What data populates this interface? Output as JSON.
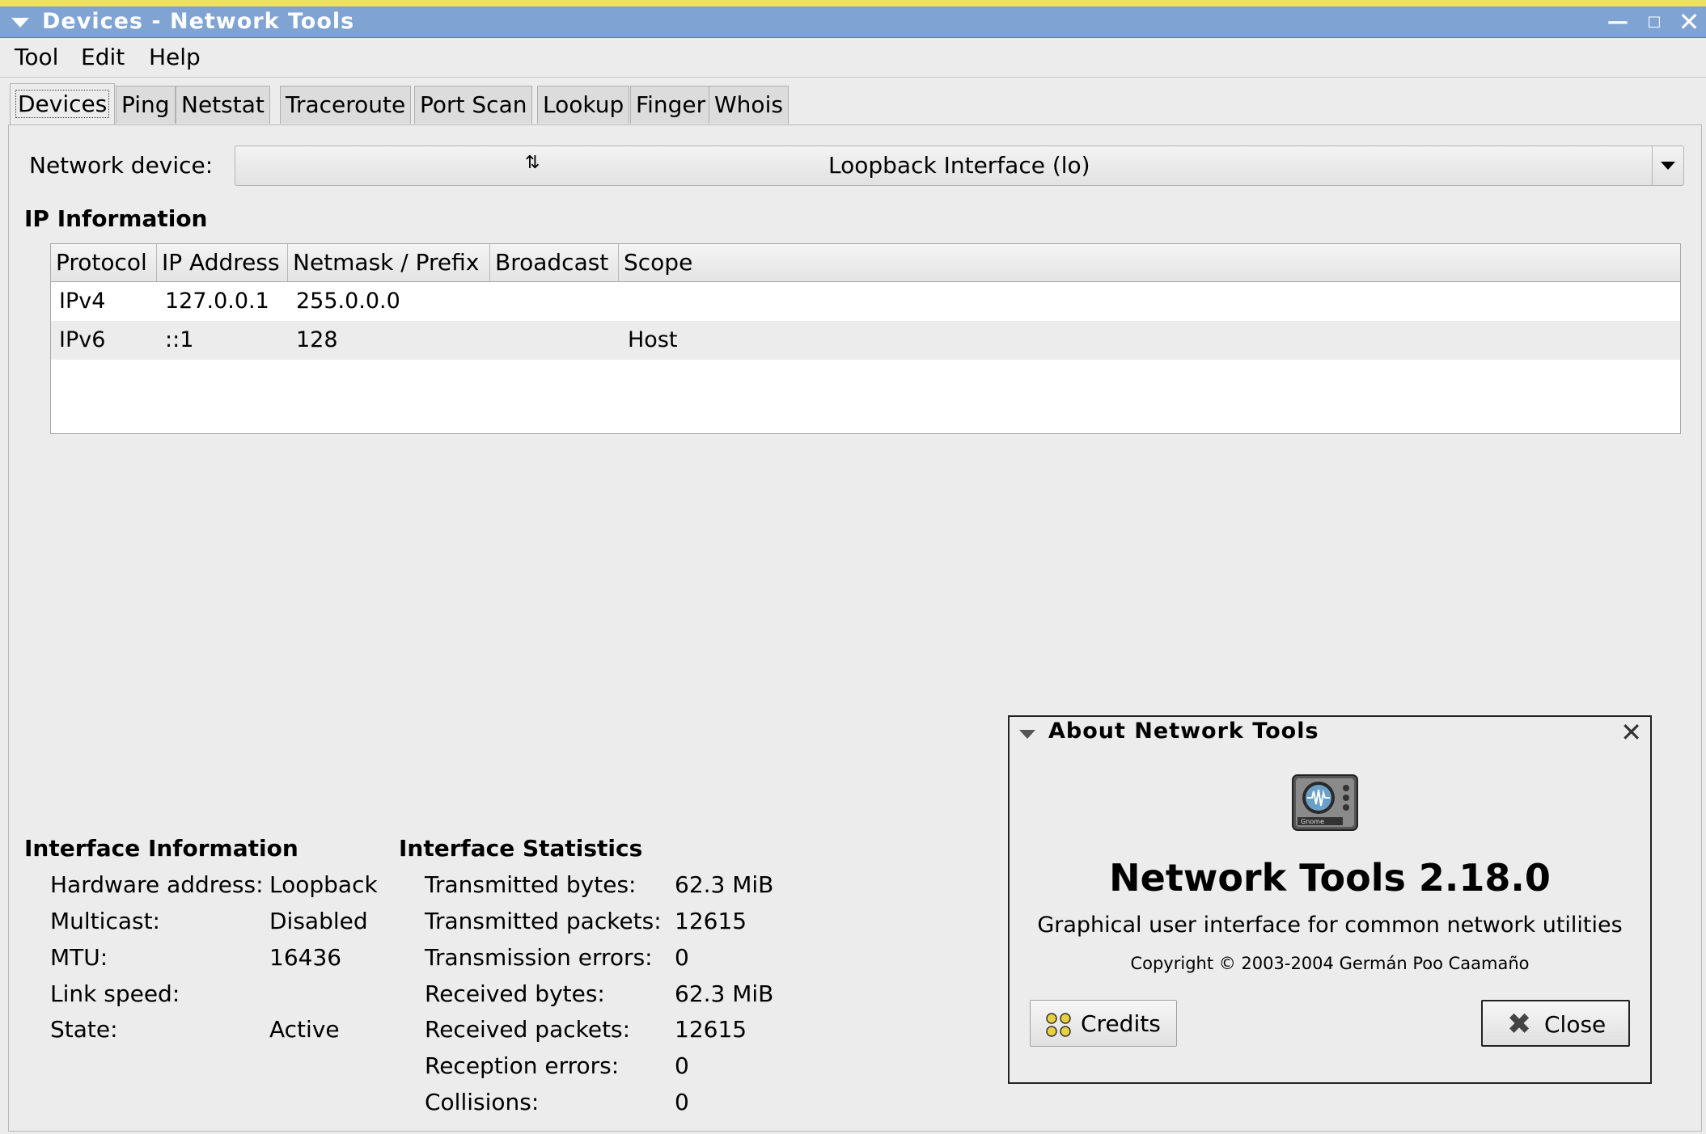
{
  "window": {
    "title": "Devices - Network Tools",
    "controls": [
      "minimize",
      "maximize",
      "close"
    ]
  },
  "menubar": [
    "Tool",
    "Edit",
    "Help"
  ],
  "tabs": [
    "Devices",
    "Ping",
    "Netstat",
    "Traceroute",
    "Port Scan",
    "Lookup",
    "Finger",
    "Whois"
  ],
  "active_tab": "Devices",
  "device": {
    "label": "Network device:",
    "selected": "Loopback Interface (lo)"
  },
  "ip_info": {
    "heading": "IP Information",
    "columns": [
      "Protocol",
      "IP Address",
      "Netmask / Prefix",
      "Broadcast",
      "Scope"
    ],
    "rows": [
      [
        "IPv4",
        "127.0.0.1",
        "255.0.0.0",
        "",
        ""
      ],
      [
        "IPv6",
        "::1",
        "128",
        "",
        "Host"
      ]
    ]
  },
  "interface_info": {
    "heading": "Interface Information",
    "rows": [
      {
        "label": "Hardware address:",
        "value": "Loopback"
      },
      {
        "label": "Multicast:",
        "value": "Disabled"
      },
      {
        "label": "MTU:",
        "value": "16436"
      },
      {
        "label": "Link speed:",
        "value": ""
      },
      {
        "label": "State:",
        "value": "Active"
      }
    ]
  },
  "interface_stats": {
    "heading": "Interface Statistics",
    "rows": [
      {
        "label": "Transmitted bytes:",
        "value": "62.3 MiB"
      },
      {
        "label": "Transmitted packets:",
        "value": "12615"
      },
      {
        "label": "Transmission errors:",
        "value": "0"
      },
      {
        "label": "Received bytes:",
        "value": "62.3 MiB"
      },
      {
        "label": "Received packets:",
        "value": "12615"
      },
      {
        "label": "Reception errors:",
        "value": "0"
      },
      {
        "label": "Collisions:",
        "value": "0"
      }
    ]
  },
  "about": {
    "title": "About Network Tools",
    "app_name": "Network Tools 2.18.0",
    "description": "Graphical user interface for common network utilities",
    "copyright": "Copyright © 2003-2004 Germán Poo Caamaño",
    "credits_label": "Credits",
    "close_label": "Close",
    "logo_text": "Gnome"
  }
}
